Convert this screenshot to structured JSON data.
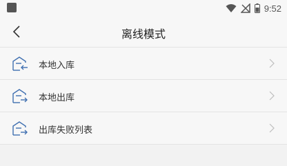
{
  "status_bar": {
    "time": "9:52",
    "icons": [
      "wifi-icon",
      "signal-off-icon",
      "battery-icon"
    ]
  },
  "header": {
    "title": "离线模式",
    "back_icon": "chevron-left-icon"
  },
  "menu": {
    "items": [
      {
        "label": "本地入库",
        "icon": "warehouse-in-icon"
      },
      {
        "label": "本地出库",
        "icon": "warehouse-out-icon"
      },
      {
        "label": "出库失败列表",
        "icon": "warehouse-out-icon"
      }
    ]
  },
  "colors": {
    "accent": "#3f6fb0",
    "background": "#f2f2f2",
    "surface": "#f7f7f7"
  }
}
